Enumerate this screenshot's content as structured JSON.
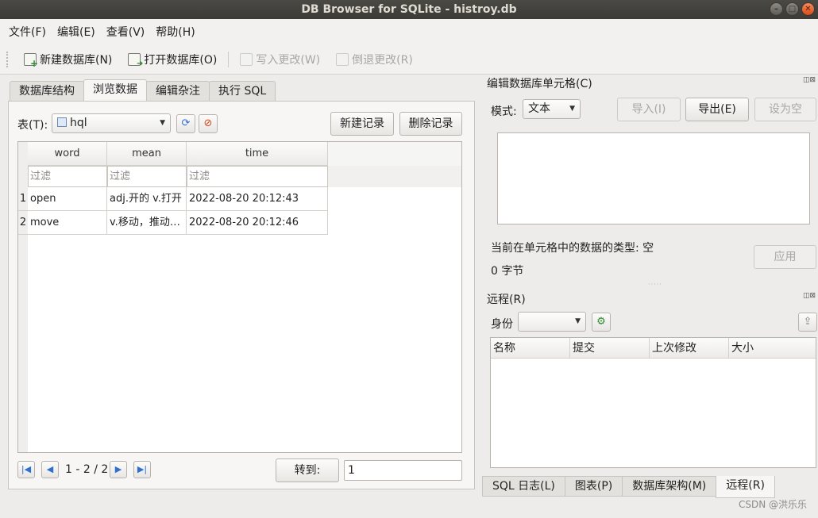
{
  "window": {
    "title": "DB Browser for SQLite - histroy.db"
  },
  "menu": [
    "文件(F)",
    "编辑(E)",
    "查看(V)",
    "帮助(H)"
  ],
  "toolbar": {
    "new_db": "新建数据库(N)",
    "open_db": "打开数据库(O)",
    "write_changes": "写入更改(W)",
    "revert_changes": "倒退更改(R)"
  },
  "tabs": [
    "数据库结构",
    "浏览数据",
    "编辑杂注",
    "执行 SQL"
  ],
  "browse": {
    "table_label": "表(T):",
    "table_name": "hql",
    "new_record": "新建记录",
    "delete_record": "删除记录",
    "columns": [
      "word",
      "mean",
      "time"
    ],
    "filter_placeholder": "过滤",
    "rows": [
      {
        "num": "1",
        "word": "open",
        "mean": "adj.开的 v.打开",
        "time": "2022-08-20 20:12:43"
      },
      {
        "num": "2",
        "word": "move",
        "mean": "v.移动，推动…",
        "time": "2022-08-20 20:12:46"
      }
    ],
    "page_info": "1 - 2 / 2",
    "goto_label": "转到:",
    "goto_value": "1"
  },
  "edit_cell": {
    "title": "编辑数据库单元格(C)",
    "mode_label": "模式:",
    "mode_value": "文本",
    "import": "导入(I)",
    "export": "导出(E)",
    "set_null": "设为空",
    "type_info": "当前在单元格中的数据的类型: 空",
    "size_info": "0 字节",
    "apply": "应用"
  },
  "remote": {
    "title": "远程(R)",
    "identity_label": "身份",
    "columns": [
      "名称",
      "提交",
      "上次修改",
      "大小"
    ]
  },
  "bottom_tabs": [
    "SQL 日志(L)",
    "图表(P)",
    "数据库架构(M)",
    "远程(R)"
  ],
  "watermark": "CSDN @洪乐乐"
}
